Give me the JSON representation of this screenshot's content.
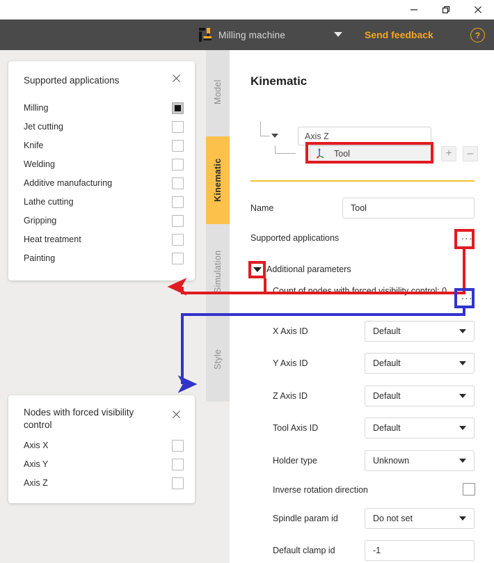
{
  "window": {
    "buttons": [
      {
        "name": "minimize",
        "icon": "minimize-icon"
      },
      {
        "name": "restore",
        "icon": "restore-icon"
      },
      {
        "name": "close",
        "icon": "close-icon"
      }
    ]
  },
  "header": {
    "machine_label": "Milling machine",
    "machine_icon": "milling-machine-icon",
    "caret_icon": "chevron-down-icon",
    "send_feedback": "Send feedback",
    "help_label": "?",
    "bg_color": "#4a4a4a",
    "accent_color": "#f5a623"
  },
  "tabs": [
    {
      "label": "Model",
      "active": false
    },
    {
      "label": "Kinematic",
      "active": true
    },
    {
      "label": "Simulation",
      "active": false
    },
    {
      "label": "Style",
      "active": false
    }
  ],
  "supported_applications_panel": {
    "title": "Supported applications",
    "close_icon": "close-icon",
    "items": [
      {
        "label": "Milling",
        "state": "partial"
      },
      {
        "label": "Jet cutting",
        "state": "unchecked"
      },
      {
        "label": "Knife",
        "state": "unchecked"
      },
      {
        "label": "Welding",
        "state": "unchecked"
      },
      {
        "label": "Additive manufacturing",
        "state": "unchecked"
      },
      {
        "label": "Lathe cutting",
        "state": "unchecked"
      },
      {
        "label": "Gripping",
        "state": "unchecked"
      },
      {
        "label": "Heat treatment",
        "state": "unchecked"
      },
      {
        "label": "Painting",
        "state": "unchecked"
      }
    ]
  },
  "visibility_panel": {
    "title": "Nodes with forced visibility control",
    "close_icon": "close-icon",
    "items": [
      {
        "label": "Axis X",
        "state": "unchecked"
      },
      {
        "label": "Axis Y",
        "state": "unchecked"
      },
      {
        "label": "Axis Z",
        "state": "unchecked"
      }
    ]
  },
  "main": {
    "title": "Kinematic",
    "tree": {
      "parent_value": "Axis Z",
      "parent_caret": "chevron-down-icon",
      "child_label": "Tool",
      "child_icon": "axis-triad-icon",
      "add_button": "+",
      "remove_button": "–"
    },
    "fields": [
      {
        "label": "Name",
        "type": "input",
        "value": "Tool"
      },
      {
        "label": "Supported applications",
        "type": "dots",
        "value": "···"
      },
      {
        "label": "Additional parameters",
        "type": "disclosure"
      },
      {
        "label": "Count of nodes with forced visibility control: 0",
        "type": "dots",
        "value": "···"
      },
      {
        "label": "X Axis ID",
        "type": "select",
        "value": "Default"
      },
      {
        "label": "Y Axis ID",
        "type": "select",
        "value": "Default"
      },
      {
        "label": "Z Axis ID",
        "type": "select",
        "value": "Default"
      },
      {
        "label": "Tool Axis ID",
        "type": "select",
        "value": "Default"
      },
      {
        "label": "Holder type",
        "type": "select",
        "value": "Unknown"
      },
      {
        "label": "Inverse rotation direction",
        "type": "checkbox",
        "value": "unchecked"
      },
      {
        "label": "Spindle param id",
        "type": "select",
        "value": "Do not set"
      },
      {
        "label": "Default clamp id",
        "type": "input",
        "value": "-1"
      }
    ]
  },
  "annotations": {
    "red_color": "#e01c22",
    "blue_color": "#3333cc",
    "red_targets": [
      "tool-tree-node",
      "supported-applications-dots",
      "additional-parameters-disclosure",
      "supported-applications-panel"
    ],
    "blue_targets": [
      "count-of-nodes-dots",
      "nodes-with-forced-visibility-panel"
    ]
  }
}
